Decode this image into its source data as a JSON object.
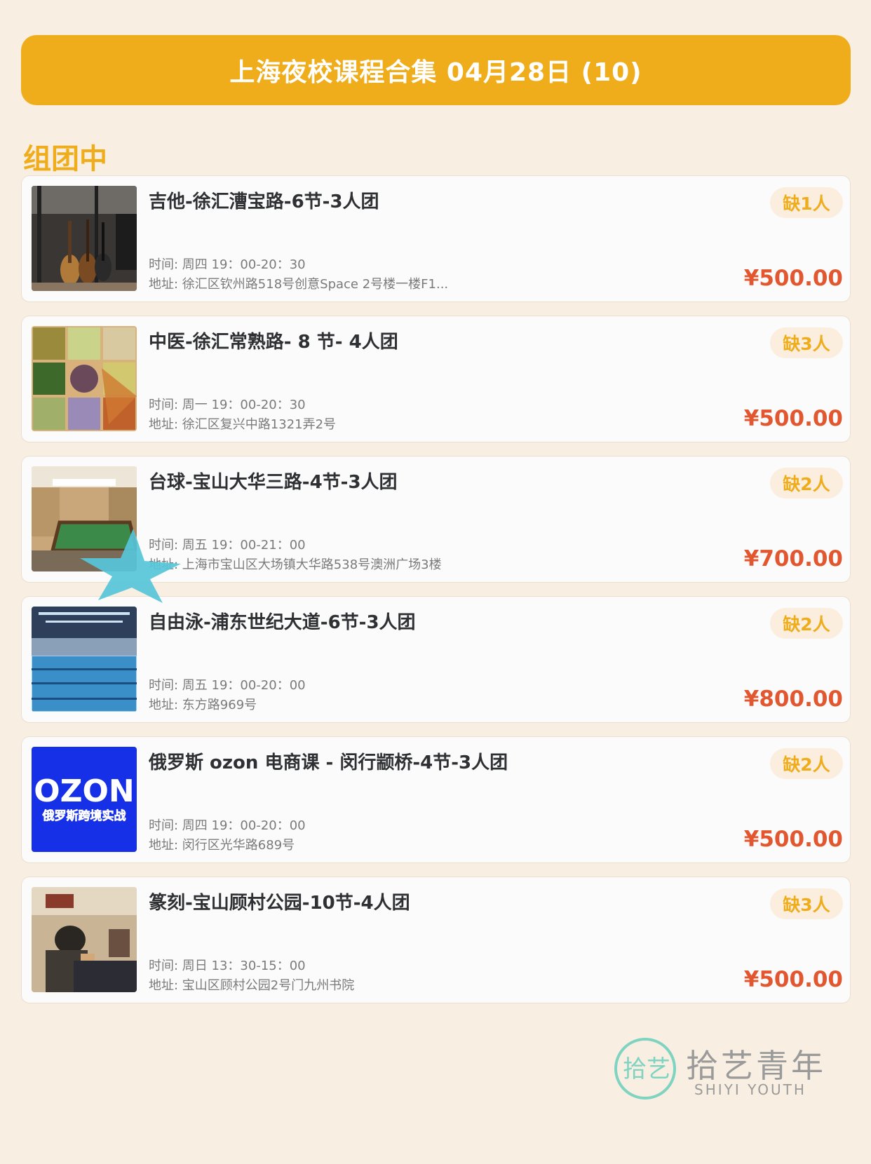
{
  "header": {
    "title": "上海夜校课程合集 04月28日 (10)"
  },
  "section": {
    "title": "组团中"
  },
  "labels": {
    "time_prefix": "时间: ",
    "address_prefix": "地址: "
  },
  "courses": [
    {
      "title": "吉他-徐汇漕宝路-6节-3人团",
      "badge": "缺1人",
      "time": "周四 19：00-20：30",
      "address": "徐汇区钦州路518号创意Space 2号楼一楼F1...",
      "price": "¥500.00",
      "image": "guitar-studio-photo"
    },
    {
      "title": "中医-徐汇常熟路- 8 节- 4人团",
      "badge": "缺3人",
      "time": "周一 19：00-20：30",
      "address": "徐汇区复兴中路1321弄2号",
      "price": "¥500.00",
      "image": "herbal-medicine-photo"
    },
    {
      "title": "台球-宝山大华三路-4节-3人团",
      "badge": "缺2人",
      "time": "周五 19：00-21：00",
      "address": "上海市宝山区大场镇大华路538号澳洲广场3楼",
      "price": "¥700.00",
      "image": "billiards-room-photo"
    },
    {
      "title": "自由泳-浦东世纪大道-6节-3人团",
      "badge": "缺2人",
      "time": "周五 19：00-20：00",
      "address": "东方路969号",
      "price": "¥800.00",
      "image": "indoor-pool-photo"
    },
    {
      "title": "俄罗斯 ozon 电商课 - 闵行颛桥-4节-3人团",
      "badge": "缺2人",
      "time": "周四 19：00-20：00",
      "address": "闵行区光华路689号",
      "price": "¥500.00",
      "image": "ozon-banner",
      "image_text": "OZON",
      "image_subtext": "俄罗斯跨境实战"
    },
    {
      "title": "篆刻-宝山顾村公园-10节-4人团",
      "badge": "缺3人",
      "time": "周日 13：30-15：00",
      "address": "宝山区顾村公园2号门九州书院",
      "price": "¥500.00",
      "image": "seal-carving-photo"
    }
  ],
  "logo": {
    "mark": "拾艺",
    "name_cn": "拾艺青年",
    "name_en": "SHIYI YOUTH"
  },
  "colors": {
    "accent": "#f0ad1b",
    "price": "#e2572f",
    "background": "#f8efe2",
    "logo": "#7fd3c1"
  }
}
